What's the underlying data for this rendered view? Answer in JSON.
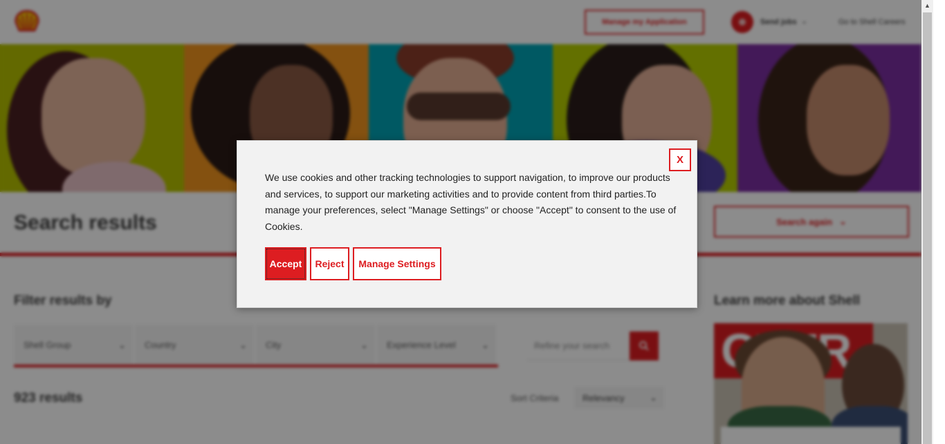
{
  "header": {
    "manage_application": "Manage my Application",
    "send_jobs": "Send jobs",
    "go_careers": "Go to Shell Careers"
  },
  "hero": {
    "panels": [
      {
        "bg": "#b4c000"
      },
      {
        "bg": "#f0941e"
      },
      {
        "bg": "#00a3b4"
      },
      {
        "bg": "#b4cc00"
      },
      {
        "bg": "#7a2ea0"
      }
    ]
  },
  "main": {
    "title": "Search results",
    "search_again": "Search again",
    "filter_heading": "Filter results by",
    "filters": [
      {
        "label": "Shell Group"
      },
      {
        "label": "Country"
      },
      {
        "label": "City"
      },
      {
        "label": "Experience Level"
      }
    ],
    "refine_placeholder": "Refine your search",
    "result_count": "923 results",
    "sort_label": "Sort Criteria",
    "sort_value": "Relevancy"
  },
  "sidebar": {
    "learn_heading": "Learn more about Shell",
    "image_banner_text": "OVER"
  },
  "cookie_modal": {
    "close_label": "X",
    "message": "We use cookies and other tracking technologies to support navigation, to improve our products and services, to support our marketing activities and to provide content from third parties.To manage your preferences, select \"Manage Settings\" or choose \"Accept\" to consent to the use of Cookies.",
    "accept": "Accept",
    "reject": "Reject",
    "manage_settings": "Manage Settings"
  },
  "colors": {
    "brand_red": "#dd1d21",
    "brand_yellow": "#fbce07"
  }
}
